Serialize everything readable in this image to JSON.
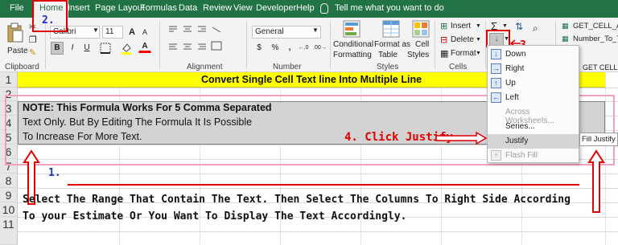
{
  "menu": {
    "tabs": [
      "File",
      "Home",
      "Insert",
      "Page Layout",
      "Formulas",
      "Data",
      "Review",
      "View",
      "Developer",
      "Help"
    ],
    "tell_me": "Tell me what you want to do"
  },
  "ribbon": {
    "clipboard": {
      "paste": "Paste",
      "label": "Clipboard"
    },
    "font": {
      "name": "Calibri",
      "size": "11",
      "bold": "B",
      "italic": "I",
      "underline": "U",
      "increase": "A",
      "decrease": "A",
      "font_color": "A"
    },
    "alignment": {
      "label": "Alignment"
    },
    "number": {
      "format": "General",
      "label": "Number",
      "currency": "$",
      "percent": "%",
      "comma": ",",
      "inc_dec": "←.0",
      "dec_dec": ".00→"
    },
    "styles": {
      "conditional": "Conditional",
      "formatting": "Formatting",
      "format_as": "Format as",
      "table": "Table",
      "cell": "Cell",
      "styles_word": "Styles",
      "label": "Styles"
    },
    "cells": {
      "insert": "Insert",
      "delete": "Delete",
      "format": "Format",
      "label": "Cells"
    },
    "editing": {
      "sigma": "Σ",
      "fill_arrow": "↓",
      "clear": "◈"
    },
    "addins": {
      "item1": "GET_CELL_AD",
      "item2": "Number_To_T",
      "item3": "GET CELL ADD"
    }
  },
  "fill_menu": {
    "items": [
      {
        "label": "Down",
        "icon": "↓",
        "disabled": false
      },
      {
        "label": "Right",
        "icon": "→",
        "disabled": false
      },
      {
        "label": "Up",
        "icon": "↑",
        "disabled": false
      },
      {
        "label": "Left",
        "icon": "←",
        "disabled": false
      },
      {
        "label": "Across Worksheets...",
        "icon": "",
        "disabled": true
      },
      {
        "label": "Series...",
        "icon": "",
        "disabled": false
      },
      {
        "label": "Justify",
        "icon": "",
        "disabled": false
      },
      {
        "label": "Flash Fill",
        "icon": "⚡",
        "disabled": true
      }
    ],
    "tooltip": "Fill Justify"
  },
  "sheet": {
    "row_numbers": [
      "1",
      "2",
      "3",
      "4",
      "5",
      "6",
      "7",
      "8",
      "9",
      "10",
      "11"
    ],
    "title": "Convert Single Cell Text line Into Multiple Line",
    "line1": "NOTE: This Formula Works For 5 Comma Separated",
    "line2": "Text Only. But By Editing The Formula It Is Possible",
    "line3": "To Increase For More Text."
  },
  "annotations": {
    "step1": "1.",
    "step2": "2.",
    "step3": "3.",
    "step4": "4. Click Justify",
    "instruction1": "Select The Range That Contain The Text. Then Select The Columns To Right Side According",
    "instruction2": "To your Estimate Or You Want To Display The Text Accordingly."
  },
  "colors": {
    "menubar": "#217346",
    "highlight_row": "#ffff00",
    "selection": "#d3d3d3",
    "annotation_red": "#e00000",
    "annotation_blue": "#1f2fc8",
    "frame_pink": "#f4a0bd"
  }
}
